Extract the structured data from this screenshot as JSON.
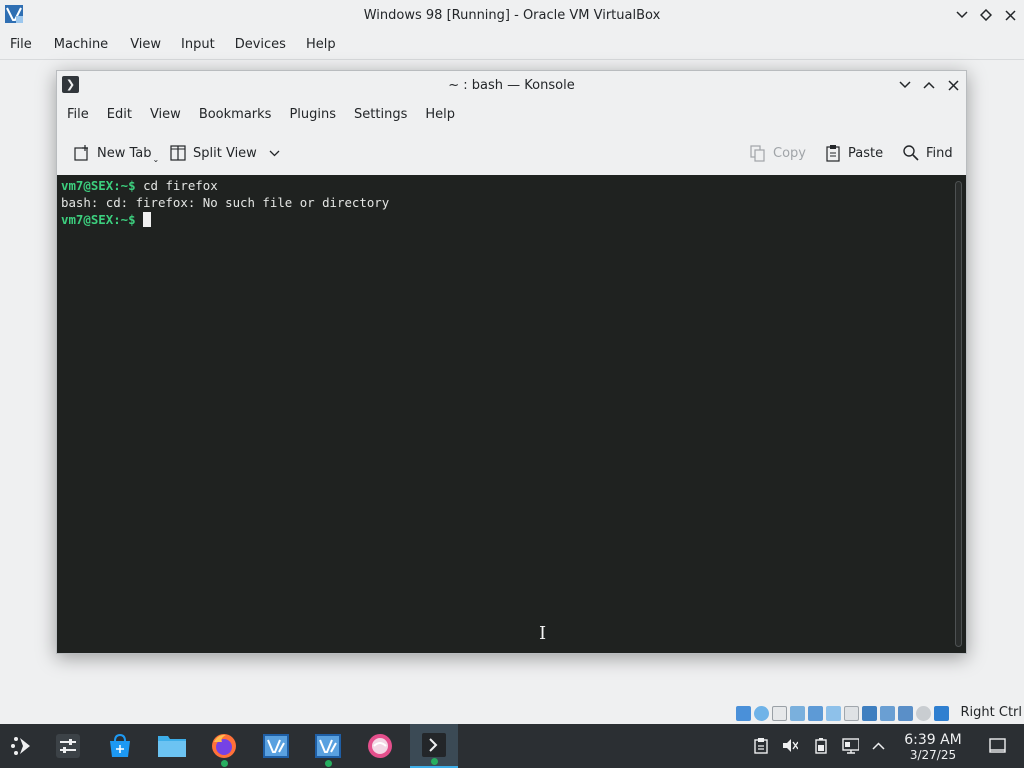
{
  "vbox": {
    "title": "Windows 98 [Running] - Oracle VM VirtualBox",
    "menu": [
      "File",
      "Machine",
      "View",
      "Input",
      "Devices",
      "Help"
    ],
    "host_key": "Right Ctrl"
  },
  "konsole": {
    "title": "~ : bash — Konsole",
    "menu": [
      "File",
      "Edit",
      "View",
      "Bookmarks",
      "Plugins",
      "Settings",
      "Help"
    ],
    "toolbar": {
      "new_tab": "New Tab",
      "split_view": "Split View",
      "copy": "Copy",
      "paste": "Paste",
      "find": "Find"
    },
    "terminal": {
      "prompt": "vm7@SEX:~$",
      "lines": [
        {
          "prompt": "vm7@SEX:~$",
          "text": " cd firefox"
        },
        {
          "prompt": "",
          "text": "bash: cd: firefox: No such file or directory"
        },
        {
          "prompt": "vm7@SEX:~$",
          "text": " "
        }
      ]
    }
  },
  "taskbar": {
    "clock_time": "6:39 AM",
    "clock_date": "3/27/25",
    "apps": [
      "application-launcher",
      "system-settings",
      "discover",
      "dolphin",
      "firefox",
      "virtualbox",
      "virtualbox",
      "plasma-app",
      "konsole"
    ]
  },
  "colors": {
    "prompt_green": "#3ccf7e",
    "terminal_bg": "#1f2220",
    "taskbar_bg": "#2b2f33",
    "accent": "#3daee9"
  }
}
